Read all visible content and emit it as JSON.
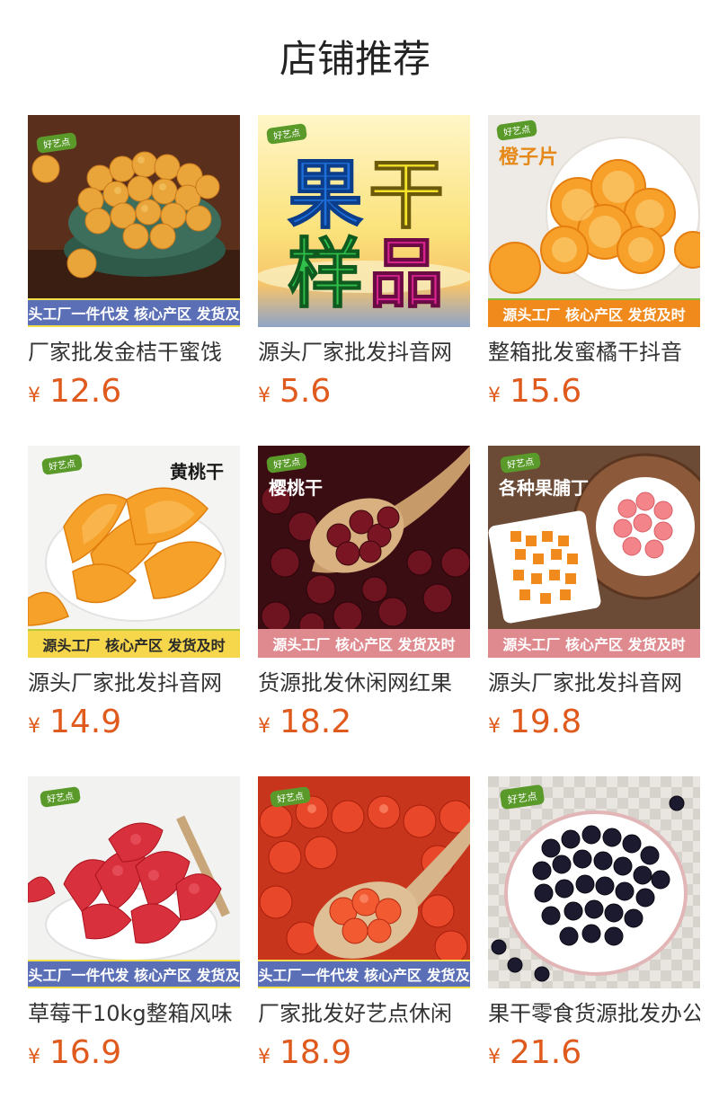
{
  "page": {
    "title": "店铺推荐"
  },
  "colors": {
    "price": "#e05a1d",
    "banner_blue": "#5a6fb6",
    "banner_orange": "#f08a1c",
    "banner_yellow": "#f6d64a",
    "banner_pink": "#de8a8f"
  },
  "products": [
    {
      "title": "厂家批发金桔干蜜饯",
      "currency": "¥",
      "price": "12.6",
      "banner": "源头工厂一件代发 核心产区 发货及时",
      "image_text": "",
      "logo_text": "好艺点",
      "image_icon": "kumquat-bowl-image"
    },
    {
      "title": "源头厂家批发抖音网",
      "currency": "¥",
      "price": "5.6",
      "banner": "",
      "image_text": "",
      "image_text_lines": [
        "果",
        "干",
        "样",
        "品"
      ],
      "logo_text": "好艺点",
      "image_icon": "dried-fruit-sample-poster-image"
    },
    {
      "title": "整箱批发蜜橘干抖音",
      "currency": "¥",
      "price": "15.6",
      "banner": "源头工厂  核心产区  发货及时",
      "image_text": "橙子片",
      "logo_text": "好艺点",
      "image_icon": "orange-slices-plate-image"
    },
    {
      "title": "源头厂家批发抖音网",
      "currency": "¥",
      "price": "14.9",
      "banner": "源头工厂  核心产区  发货及时",
      "image_text": "黄桃干",
      "logo_text": "好艺点",
      "image_icon": "dried-peach-plate-image"
    },
    {
      "title": "货源批发休闲网红果",
      "currency": "¥",
      "price": "18.2",
      "banner": "源头工厂  核心产区  发货及时",
      "image_text": "樱桃干",
      "logo_text": "好艺点",
      "image_icon": "dried-cherries-spoon-image"
    },
    {
      "title": "源头厂家批发抖音网",
      "currency": "¥",
      "price": "19.8",
      "banner": "源头工厂  核心产区  发货及时",
      "image_text": "各种果脯丁",
      "logo_text": "好艺点",
      "image_icon": "diced-fruit-bowls-image"
    },
    {
      "title": "草莓干10kg整箱风味",
      "currency": "¥",
      "price": "16.9",
      "banner": "源头工厂一件代发 核心产区 发货及时",
      "image_text": "",
      "logo_text": "好艺点",
      "image_icon": "dried-strawberry-bowl-image"
    },
    {
      "title": "厂家批发好艺点休闲",
      "currency": "¥",
      "price": "18.9",
      "banner": "源头工厂一件代发 核心产区 发货及时",
      "image_text": "",
      "logo_text": "好艺点",
      "image_icon": "candied-tomato-spoon-image"
    },
    {
      "title": "果干零食货源批发办公",
      "currency": "¥",
      "price": "21.6",
      "banner": "",
      "image_text": "",
      "logo_text": "好艺点",
      "image_icon": "dried-blueberry-bowl-image"
    }
  ]
}
